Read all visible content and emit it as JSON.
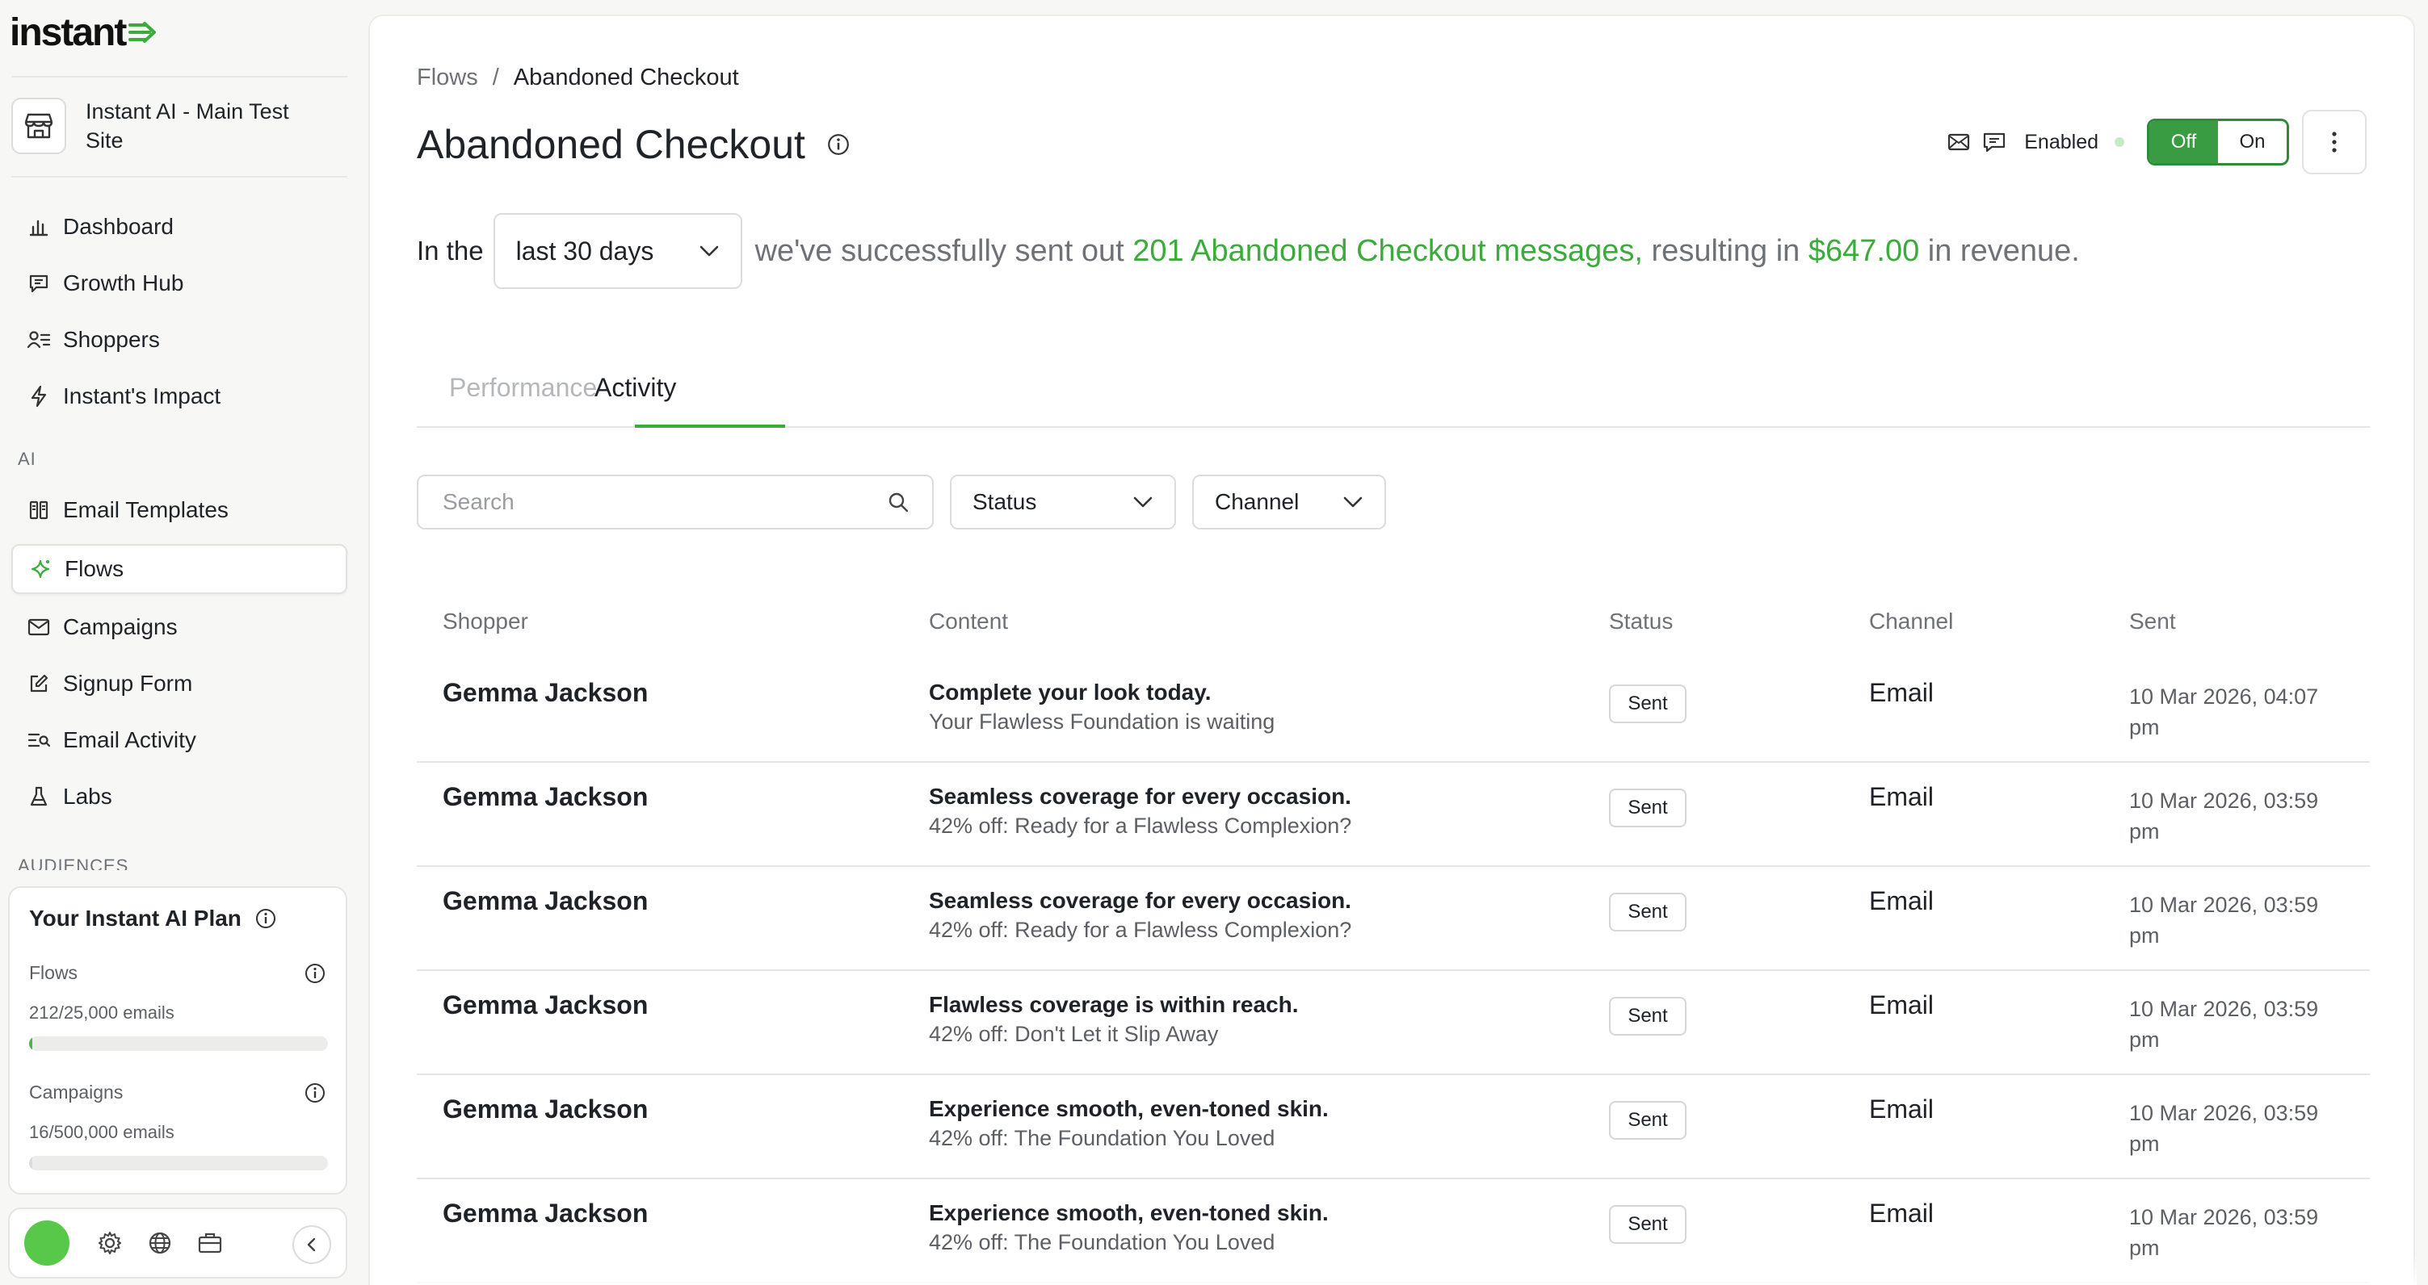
{
  "brand": {
    "logo_text": "instant",
    "accent": "#3bab3b"
  },
  "sidebar": {
    "site_name": "Instant AI - Main Test Site",
    "items_top": [
      {
        "label": "Dashboard",
        "icon": "bar-chart-icon"
      },
      {
        "label": "Growth Hub",
        "icon": "message-board-icon"
      },
      {
        "label": "Shoppers",
        "icon": "users-list-icon"
      },
      {
        "label": "Instant's Impact",
        "icon": "lightning-icon"
      }
    ],
    "section_ai": "AI",
    "items_ai": [
      {
        "label": "Email Templates",
        "icon": "templates-icon"
      },
      {
        "label": "Flows",
        "icon": "sparkle-icon",
        "active": true
      },
      {
        "label": "Campaigns",
        "icon": "envelope-icon"
      },
      {
        "label": "Signup Form",
        "icon": "edit-form-icon"
      },
      {
        "label": "Email Activity",
        "icon": "activity-list-icon"
      },
      {
        "label": "Labs",
        "icon": "flask-icon"
      }
    ],
    "section_audiences": "AUDIENCES",
    "plan": {
      "title": "Your Instant AI Plan",
      "flows_label": "Flows",
      "flows_usage": "212/25,000 emails",
      "flows_fraction": 0.00848,
      "campaigns_label": "Campaigns",
      "campaigns_usage": "16/500,000 emails",
      "campaigns_fraction": 3.2e-05
    }
  },
  "header": {
    "breadcrumb_parent": "Flows",
    "breadcrumb_sep": "/",
    "breadcrumb_current": "Abandoned Checkout",
    "title": "Abandoned Checkout",
    "enabled_label": "Enabled",
    "toggle_off": "Off",
    "toggle_on": "On"
  },
  "summary": {
    "prefix": "In the",
    "range": "last 30 days",
    "text1": "we've successfully sent out",
    "highlight1": "201 Abandoned Checkout messages,",
    "text2": "resulting in",
    "highlight2": "$647.00",
    "text3": "in revenue."
  },
  "tabs": {
    "performance": "Performance",
    "activity": "Activity"
  },
  "filters": {
    "search_placeholder": "Search",
    "status": "Status",
    "channel": "Channel"
  },
  "table": {
    "columns": [
      "Shopper",
      "Content",
      "Status",
      "Channel",
      "Sent"
    ],
    "rows": [
      {
        "shopper": "Gemma Jackson",
        "title": "Complete your look today.",
        "subtitle": "Your Flawless Foundation is waiting",
        "status": "Sent",
        "channel": "Email",
        "sent_line1": "10 Mar 2026, 04:07",
        "sent_line2": "pm"
      },
      {
        "shopper": "Gemma Jackson",
        "title": "Seamless coverage for every occasion.",
        "subtitle": "42% off: Ready for a Flawless Complexion?",
        "status": "Sent",
        "channel": "Email",
        "sent_line1": "10 Mar 2026, 03:59",
        "sent_line2": "pm"
      },
      {
        "shopper": "Gemma Jackson",
        "title": "Seamless coverage for every occasion.",
        "subtitle": "42% off: Ready for a Flawless Complexion?",
        "status": "Sent",
        "channel": "Email",
        "sent_line1": "10 Mar 2026, 03:59",
        "sent_line2": "pm"
      },
      {
        "shopper": "Gemma Jackson",
        "title": "Flawless coverage is within reach.",
        "subtitle": "42% off: Don't Let it Slip Away",
        "status": "Sent",
        "channel": "Email",
        "sent_line1": "10 Mar 2026, 03:59",
        "sent_line2": "pm"
      },
      {
        "shopper": "Gemma Jackson",
        "title": "Experience smooth, even-toned skin.",
        "subtitle": "42% off: The Foundation You Loved",
        "status": "Sent",
        "channel": "Email",
        "sent_line1": "10 Mar 2026, 03:59",
        "sent_line2": "pm"
      },
      {
        "shopper": "Gemma Jackson",
        "title": "Experience smooth, even-toned skin.",
        "subtitle": "42% off: The Foundation You Loved",
        "status": "Sent",
        "channel": "Email",
        "sent_line1": "10 Mar 2026, 03:59",
        "sent_line2": "pm"
      }
    ]
  }
}
